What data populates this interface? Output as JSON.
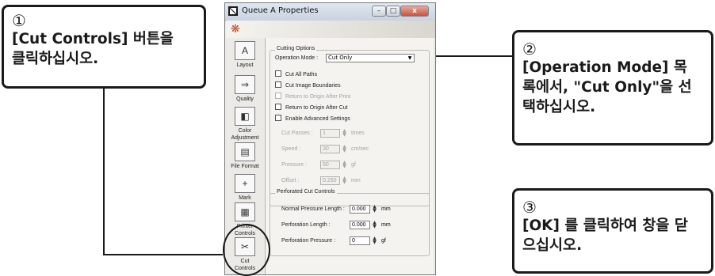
{
  "callouts": {
    "step1": {
      "num": "①",
      "text": "[Cut Controls] 버튼을\n클릭하십시오."
    },
    "step2": {
      "num": "②",
      "text": "[Operation Mode] 목\n록에서, \"Cut Only\"을 선\n택하십시오."
    },
    "step3": {
      "num": "③",
      "text": "[OK] 를 클릭하여 창을 닫\n으십시오."
    }
  },
  "window": {
    "title": "Queue A Properties",
    "close_glyph": "x",
    "min_glyph": "–",
    "max_glyph": "□"
  },
  "sidebar": {
    "items": [
      {
        "label": "Layout",
        "icon": "layout-icon",
        "glyph": "A"
      },
      {
        "label": "Quality",
        "icon": "quality-icon",
        "glyph": "⇒"
      },
      {
        "label": "Color\nAdjustment",
        "icon": "color-adjustment-icon",
        "glyph": "◧"
      },
      {
        "label": "File Format",
        "icon": "file-format-icon",
        "glyph": "▤"
      },
      {
        "label": "Mark",
        "icon": "mark-icon",
        "glyph": "+"
      },
      {
        "label": "Printer\nControls",
        "icon": "printer-controls-icon",
        "glyph": "▦"
      },
      {
        "label": "Cut\nControls",
        "icon": "cut-controls-icon",
        "glyph": "✂"
      }
    ]
  },
  "cutting_options": {
    "title": "Cutting Options",
    "operation_mode_label": "Operation Mode :",
    "operation_mode_value": "Cut Only",
    "checkboxes": [
      {
        "label": "Cut All Paths",
        "enabled": true
      },
      {
        "label": "Cut Image Boundaries",
        "enabled": true
      },
      {
        "label": "Return to Origin After Print",
        "enabled": false
      },
      {
        "label": "Return to Origin After Cut",
        "enabled": true
      },
      {
        "label": "Enable Advanced Settings",
        "enabled": true
      }
    ],
    "fields": [
      {
        "label": "Cut Passes :",
        "value": "1",
        "unit": "times"
      },
      {
        "label": "Speed :",
        "value": "30",
        "unit": "cm/sec"
      },
      {
        "label": "Pressure :",
        "value": "50",
        "unit": "gf"
      },
      {
        "label": "Offset :",
        "value": "0.250",
        "unit": "mm"
      }
    ]
  },
  "perforated": {
    "title": "Perforated Cut Controls",
    "fields": [
      {
        "label": "Normal Pressure Length :",
        "value": "0.000",
        "unit": "mm"
      },
      {
        "label": "Perforation Length :",
        "value": "0.000",
        "unit": "mm"
      },
      {
        "label": "Perforation Pressure :",
        "value": "0",
        "unit": "gf"
      }
    ]
  }
}
